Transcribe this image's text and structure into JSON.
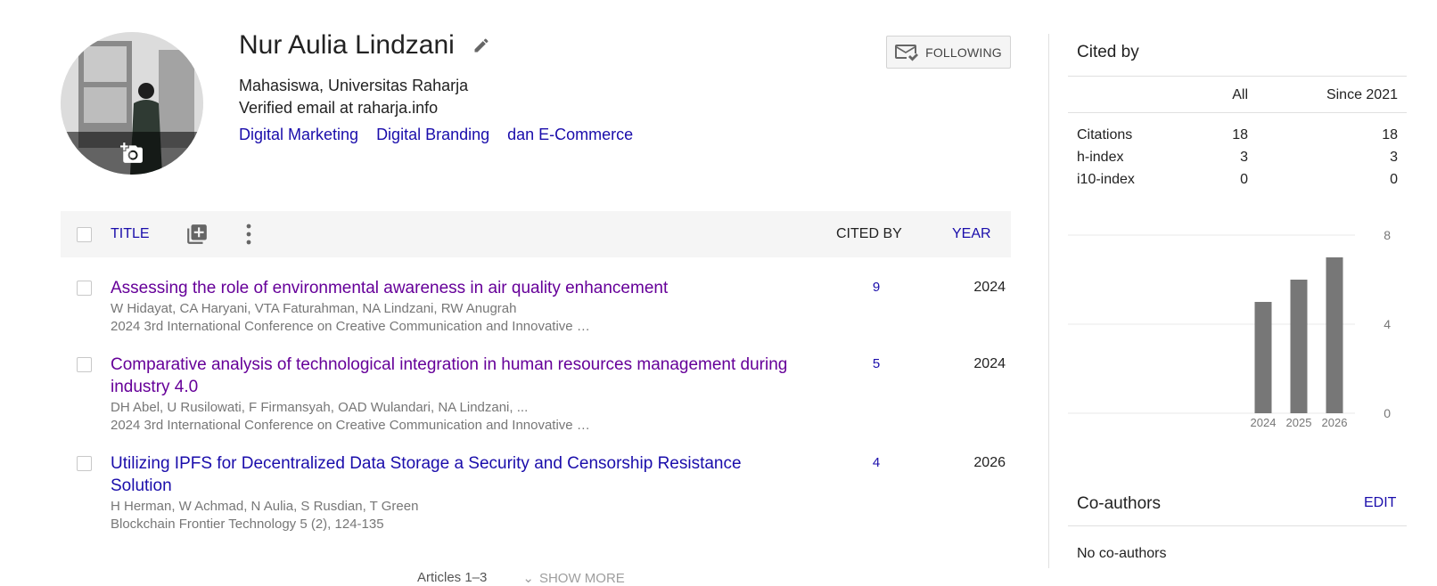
{
  "profile": {
    "name": "Nur Aulia Lindzani",
    "affiliation": "Mahasiswa, Universitas Raharja",
    "email": "Verified email at raharja.info",
    "interests": [
      "Digital Marketing",
      "Digital Branding",
      "dan E-Commerce"
    ],
    "follow_label": "FOLLOWING",
    "avatar_icon": "person-photo",
    "change_photo_icon": "add-photo-icon",
    "edit_icon": "pencil-icon"
  },
  "table": {
    "title_header": "TITLE",
    "cited_by_header": "CITED BY",
    "year_header": "YEAR",
    "add_icon": "add-to-library-icon",
    "more_icon": "more-vert-icon"
  },
  "articles": [
    {
      "title": "Assessing the role of environmental awareness in air quality enhancement",
      "authors": "W Hidayat, CA Haryani, VTA Faturahman, NA Lindzani, RW Anugrah",
      "venue": "2024 3rd International Conference on Creative Communication and Innovative …",
      "cited_by": "9",
      "year": "2024",
      "visited": true
    },
    {
      "title": "Comparative analysis of technological integration in human resources management during industry 4.0",
      "authors": "DH Abel, U Rusilowati, F Firmansyah, OAD Wulandari, NA Lindzani, ...",
      "venue": "2024 3rd International Conference on Creative Communication and Innovative …",
      "cited_by": "5",
      "year": "2024",
      "visited": true
    },
    {
      "title": "Utilizing IPFS for Decentralized Data Storage a Security and Censorship Resistance Solution",
      "authors": "H Herman, W Achmad, N Aulia, S Rusdian, T Green",
      "venue": "Blockchain Frontier Technology 5 (2), 124-135",
      "cited_by": "4",
      "year": "2026",
      "visited": false
    }
  ],
  "footer": {
    "articles_label": "Articles 1–3",
    "show_more": "SHOW MORE"
  },
  "cited_by": {
    "title": "Cited by",
    "col_all": "All",
    "col_since": "Since 2021",
    "rows": [
      {
        "label": "Citations",
        "all": "18",
        "since": "18"
      },
      {
        "label": "h-index",
        "all": "3",
        "since": "3"
      },
      {
        "label": "i10-index",
        "all": "0",
        "since": "0"
      }
    ]
  },
  "chart_data": {
    "type": "bar",
    "categories": [
      "2024",
      "2025",
      "2026"
    ],
    "values": [
      5,
      6,
      7
    ],
    "ylim": [
      0,
      8
    ],
    "yticks": [
      "0",
      "4",
      "8"
    ],
    "bar_color": "#777777",
    "grid": true
  },
  "coauthors": {
    "title": "Co-authors",
    "edit": "EDIT",
    "empty": "No co-authors"
  },
  "colors": {
    "link": "#1a0dab",
    "visited": "#660099",
    "header_bg": "#f5f5f5"
  }
}
